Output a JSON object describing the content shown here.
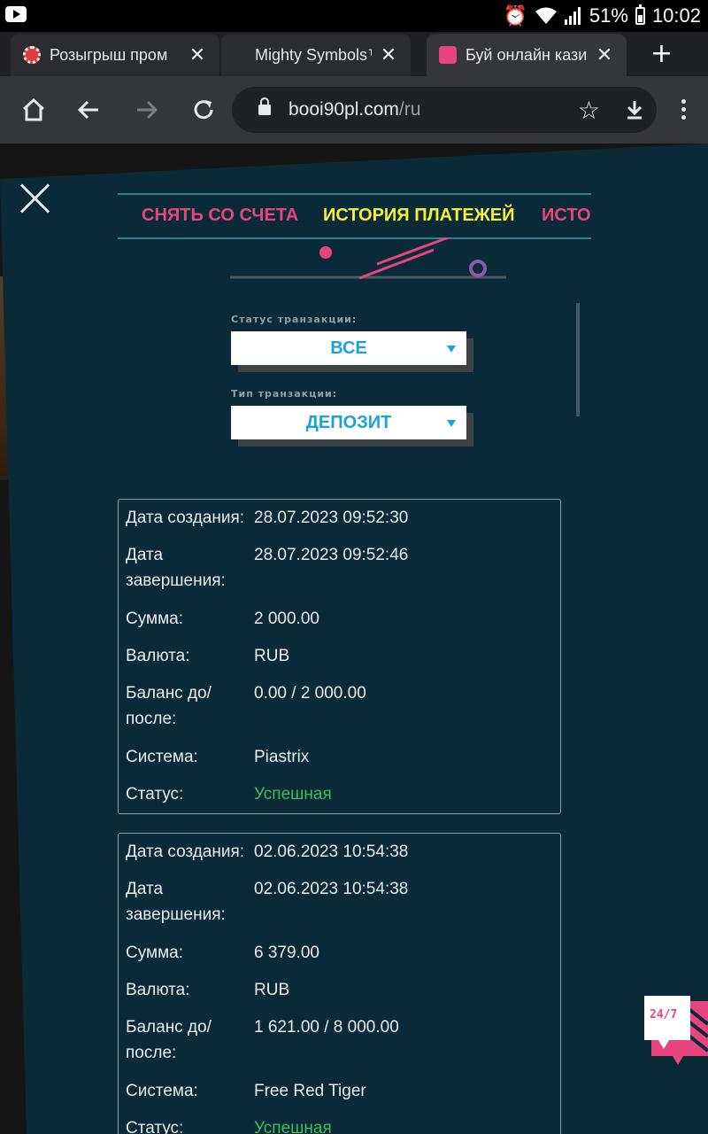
{
  "status_bar": {
    "battery": "51%",
    "time": "10:02",
    "icons": [
      "youtube-icon",
      "alarm-icon",
      "wifi-icon",
      "signal-icon",
      "battery-icon"
    ]
  },
  "browser": {
    "tabs": [
      {
        "title": "Розыгрыш пром",
        "favicon": "poker-chip-icon",
        "active": false
      },
      {
        "title": "Mighty Symbols™",
        "favicon": "none",
        "active": false
      },
      {
        "title": "Буй онлайн кази",
        "favicon": "booi-logo-icon",
        "active": true
      }
    ],
    "url_host": "booi90pl.com",
    "url_path": "/ru",
    "toolbar_icons": [
      "home-icon",
      "back-icon",
      "forward-icon",
      "reload-icon",
      "lock-icon",
      "star-icon",
      "download-icon",
      "menu-icon"
    ]
  },
  "modal": {
    "tabs": [
      "СНЯТЬ СО СЧЕТА",
      "ИСТОРИЯ ПЛАТЕЖЕЙ",
      "ИСТОРИЯ"
    ],
    "active_tab": "ИСТОРИЯ ПЛАТЕЖЕЙ",
    "filters": {
      "status_label": "Статус транзакции:",
      "status_value": "ВСЕ",
      "type_label": "Тип транзакции:",
      "type_value": "ДЕПОЗИТ"
    },
    "labels": {
      "created": "Дата создания:",
      "completed": "Дата завершения:",
      "amount": "Сумма:",
      "currency": "Валюта:",
      "balance": "Баланс до/ после:",
      "system": "Система:",
      "status": "Статус:"
    },
    "transactions": [
      {
        "created": "28.07.2023 09:52:30",
        "completed": "28.07.2023 09:52:46",
        "amount": "2 000.00",
        "currency": "RUB",
        "balance": "0.00 / 2 000.00",
        "system": "Piastrix",
        "status": "Успешная"
      },
      {
        "created": "02.06.2023 10:54:38",
        "completed": "02.06.2023 10:54:38",
        "amount": "6 379.00",
        "currency": "RUB",
        "balance": "1 621.00 / 8 000.00",
        "system": "Free Red Tiger",
        "status": "Успешная"
      }
    ]
  },
  "support_badge": "24/7",
  "colors": {
    "panel": "#0a2a37",
    "accent_pink": "#e8457f",
    "accent_yellow": "#f7f03a",
    "select_text": "#1ba1dc",
    "success": "#3fbf5a"
  }
}
